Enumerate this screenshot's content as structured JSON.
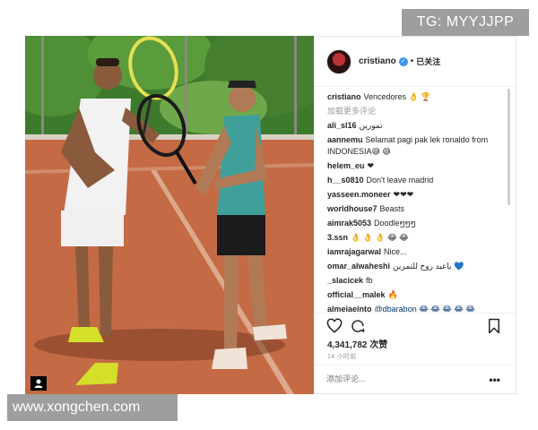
{
  "watermark": {
    "top": "TG: MYYJJPP",
    "bottom": "www.xongchen.com"
  },
  "post": {
    "username": "cristiano",
    "separator": "•",
    "follow_status": "已关注",
    "comments": [
      {
        "user": "cristiano",
        "text": "Vencedores 👌 🏆"
      },
      {
        "user": "",
        "text": "加载更多评论",
        "type": "more"
      },
      {
        "user": "ali_sl16",
        "text": "تمورين"
      },
      {
        "user": "aannemu",
        "text": "Selamat pagi pak lek ronaldo from INDONESIA😅 😅",
        "type": "wrap"
      },
      {
        "user": "helem_eu",
        "text": "❤"
      },
      {
        "user": "h__s0810",
        "text": "Don't leave madrid"
      },
      {
        "user": "yasseen.moneer",
        "text": "❤❤❤"
      },
      {
        "user": "worldhouse7",
        "text": "Beasts"
      },
      {
        "user": "aimrak5053",
        "text": "Doodleໆໆໆ"
      },
      {
        "user": "3.ssn",
        "text": "👌 👌 👌 😂 😂"
      },
      {
        "user": "iamrajagarwal",
        "text": "Nice..."
      },
      {
        "user": "omar_alwaheshi",
        "text": "ياعيد روح للتمرين 💙"
      },
      {
        "user": "_slacicek",
        "text": "fb"
      },
      {
        "user": "official__malek",
        "text": "🔥"
      },
      {
        "user": "almeiaeinto",
        "text": "@dbarabon 😂 😂 😂 😂 😂"
      }
    ],
    "likes": "4,341,782 次赞",
    "time_ago": "14 小时前",
    "comment_placeholder": "添加评论...",
    "more_options": "•••"
  },
  "colors": {
    "verified": "#3897f0",
    "court": "#c46a45",
    "tree": "#3d7a2c"
  },
  "icons": [
    "heart-icon",
    "comment-icon",
    "bookmark-icon",
    "verified-icon",
    "profile-icon"
  ]
}
